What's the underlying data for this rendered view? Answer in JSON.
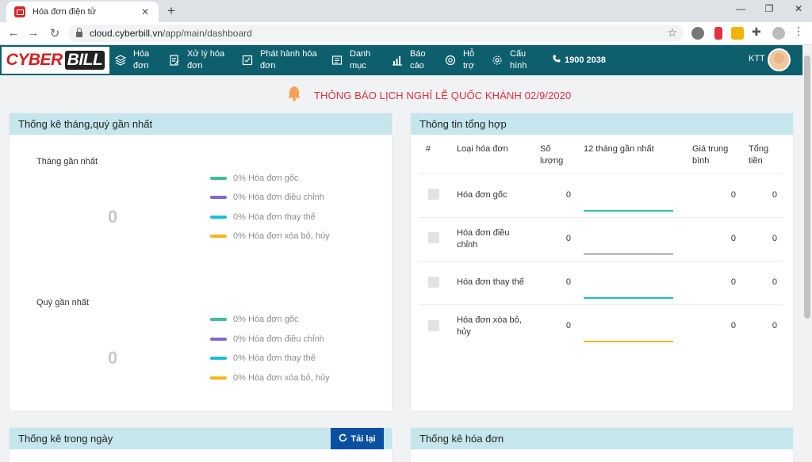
{
  "browser": {
    "tab_title": "Hóa đơn điện tử",
    "url_domain": "cloud.cyberbill.vn",
    "url_path": "/app/main/dashboard"
  },
  "app": {
    "logo_left": "CYBER",
    "logo_right": "BILL",
    "menu": [
      {
        "icon": "layers-icon",
        "label": "Hóa đơn"
      },
      {
        "icon": "document-edit-icon",
        "label": "Xử lý hóa đơn"
      },
      {
        "icon": "checkbox-icon",
        "label": "Phát hành hóa đơn"
      },
      {
        "icon": "list-icon",
        "label": "Danh mục"
      },
      {
        "icon": "chart-icon",
        "label": "Báo cáo"
      },
      {
        "icon": "support-icon",
        "label": "Hỗ trợ"
      },
      {
        "icon": "gear-icon",
        "label": "Cấu hình"
      }
    ],
    "phone": "1900 2038",
    "user": "KTT",
    "colors": {
      "header": "#0d5f6e",
      "panel_head": "#c4e6ec",
      "notice": "#e0313f",
      "button": "#0b4fa3"
    }
  },
  "notice": "THÔNG BÁO LỊCH NGHỈ LỄ QUỐC KHÁNH 02/9/2020",
  "stats_panel": {
    "title": "Thống kê tháng,quý gần nhất",
    "month": {
      "title": "Tháng gần nhất",
      "total": "0",
      "legend": [
        {
          "text": "0% Hóa đơn gốc",
          "color": "#3bbf9b"
        },
        {
          "text": "0% Hóa đơn điều chỉnh",
          "color": "#7f6bd1"
        },
        {
          "text": "0% Hóa đơn thay thế",
          "color": "#1cbfd6"
        },
        {
          "text": "0% Hóa đơn xóa bỏ, hủy",
          "color": "#f7b519"
        }
      ]
    },
    "quarter": {
      "title": "Quý gần nhất",
      "total": "0",
      "legend": [
        {
          "text": "0% Hóa đơn gốc",
          "color": "#3bbf9b"
        },
        {
          "text": "0% Hóa đơn điều chỉnh",
          "color": "#7f6bd1"
        },
        {
          "text": "0% Hóa đơn thay thế",
          "color": "#1cbfd6"
        },
        {
          "text": "0% Hóa đơn xóa bỏ, hủy",
          "color": "#f7b519"
        }
      ]
    }
  },
  "summary_panel": {
    "title": "Thông tin tổng hợp",
    "headers": [
      "#",
      "Loại hóa đơn",
      "Số lượng",
      "12 tháng gần nhất",
      "Giá trung bình",
      "Tổng tiền"
    ],
    "rows": [
      {
        "type": "Hóa đơn gốc",
        "qty": "0",
        "avg": "0",
        "total": "0",
        "color": "#3bbf9b"
      },
      {
        "type": "Hóa đơn điều chỉnh",
        "qty": "0",
        "avg": "0",
        "total": "0",
        "color": "#4a4a6a"
      },
      {
        "type": "Hóa đơn thay thế",
        "qty": "0",
        "avg": "0",
        "total": "0",
        "color": "#1cbfd6"
      },
      {
        "type": "Hóa đơn xóa bỏ, hủy",
        "qty": "0",
        "avg": "0",
        "total": "0",
        "color": "#f7b519"
      }
    ]
  },
  "daily_panel": {
    "title": "Thống kê trong ngày",
    "reload": "Tải lại"
  },
  "invoice_panel": {
    "title": "Thống kê hóa đơn"
  }
}
